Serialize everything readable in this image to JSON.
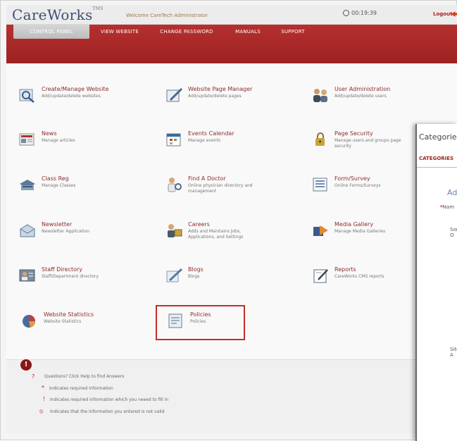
{
  "header": {
    "logo": "CareWorks",
    "logo_tm": "TMS",
    "welcome": "Welcome CareTech Administrator",
    "clock": "00:19:39",
    "logout": "Logout"
  },
  "nav": {
    "tabs": [
      "CONTROL PANEL",
      "VIEW WEBSITE",
      "CHANGE PASSWORD",
      "MANUALS",
      "SUPPORT"
    ]
  },
  "tiles": [
    {
      "title": "Create/Manage Website",
      "sub": "Add/update/delete websites",
      "icon": "magnifier-icon"
    },
    {
      "title": "Website Page Manager",
      "sub": "Add/update/delete pages",
      "icon": "page-edit-icon"
    },
    {
      "title": "User Administration",
      "sub": "Add/update/delete users",
      "icon": "users-icon"
    },
    {
      "title": "News",
      "sub": "Manage articles",
      "icon": "newspaper-icon"
    },
    {
      "title": "Events Calendar",
      "sub": "Manage events",
      "icon": "calendar-icon"
    },
    {
      "title": "Page Security",
      "sub": "Manage users and groups page security",
      "icon": "lock-icon"
    },
    {
      "title": "Class Reg",
      "sub": "Manage Classes",
      "icon": "classroom-icon"
    },
    {
      "title": "Find A Doctor",
      "sub": "Online physician directory and management",
      "icon": "doctor-icon"
    },
    {
      "title": "Form/Survey",
      "sub": "Online Forms/Surveys",
      "icon": "form-icon"
    },
    {
      "title": "Newsletter",
      "sub": "Newsletter Application",
      "icon": "envelope-icon"
    },
    {
      "title": "Careers",
      "sub": "Adds and Maintains Jobs, Applications, and Settings",
      "icon": "careers-icon"
    },
    {
      "title": "Media Gallery",
      "sub": "Manage Media Galleries",
      "icon": "media-icon"
    },
    {
      "title": "Staff Directory",
      "sub": "Staff/Department directory",
      "icon": "staff-icon"
    },
    {
      "title": "Blogs",
      "sub": "Blogs",
      "icon": "blog-icon"
    },
    {
      "title": "Reports",
      "sub": "CareWorks CMS reports",
      "icon": "reports-icon"
    },
    {
      "title": "Website Statistics",
      "sub": "Website Statistics",
      "icon": "pie-chart-icon"
    },
    {
      "title": "Policies",
      "sub": "Policies",
      "icon": "policies-icon"
    }
  ],
  "footer": {
    "help": "Questions? Click Help to find Answers",
    "required": "Indicates required information",
    "warning": "Indicates required information which you neeed to fill in",
    "error": "Indicates that the information you entered is not valid"
  },
  "panel": {
    "title": "Categories",
    "tab": "CATEGORIES",
    "add": "Ad",
    "name_label": "Nam",
    "sort_label": "Sort O",
    "site_label": "Site A"
  },
  "colors": {
    "brand_red": "#a82727",
    "title_red": "#8e2b2b",
    "logo_blue": "#3d4f74"
  }
}
